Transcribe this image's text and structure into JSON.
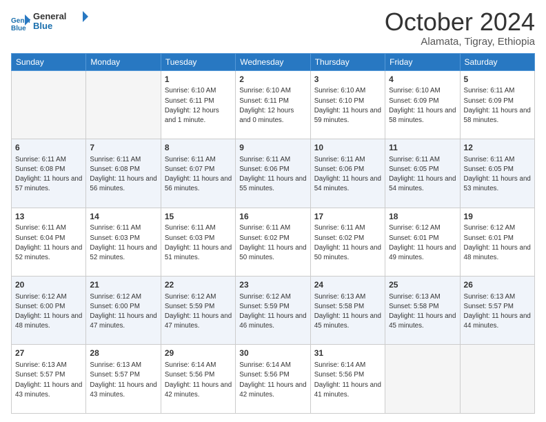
{
  "header": {
    "logo_line1": "General",
    "logo_line2": "Blue",
    "month": "October 2024",
    "location": "Alamata, Tigray, Ethiopia"
  },
  "weekdays": [
    "Sunday",
    "Monday",
    "Tuesday",
    "Wednesday",
    "Thursday",
    "Friday",
    "Saturday"
  ],
  "weeks": [
    [
      {
        "day": "",
        "info": ""
      },
      {
        "day": "",
        "info": ""
      },
      {
        "day": "1",
        "info": "Sunrise: 6:10 AM\nSunset: 6:11 PM\nDaylight: 12 hours\nand 1 minute."
      },
      {
        "day": "2",
        "info": "Sunrise: 6:10 AM\nSunset: 6:11 PM\nDaylight: 12 hours\nand 0 minutes."
      },
      {
        "day": "3",
        "info": "Sunrise: 6:10 AM\nSunset: 6:10 PM\nDaylight: 11 hours\nand 59 minutes."
      },
      {
        "day": "4",
        "info": "Sunrise: 6:10 AM\nSunset: 6:09 PM\nDaylight: 11 hours\nand 58 minutes."
      },
      {
        "day": "5",
        "info": "Sunrise: 6:11 AM\nSunset: 6:09 PM\nDaylight: 11 hours\nand 58 minutes."
      }
    ],
    [
      {
        "day": "6",
        "info": "Sunrise: 6:11 AM\nSunset: 6:08 PM\nDaylight: 11 hours\nand 57 minutes."
      },
      {
        "day": "7",
        "info": "Sunrise: 6:11 AM\nSunset: 6:08 PM\nDaylight: 11 hours\nand 56 minutes."
      },
      {
        "day": "8",
        "info": "Sunrise: 6:11 AM\nSunset: 6:07 PM\nDaylight: 11 hours\nand 56 minutes."
      },
      {
        "day": "9",
        "info": "Sunrise: 6:11 AM\nSunset: 6:06 PM\nDaylight: 11 hours\nand 55 minutes."
      },
      {
        "day": "10",
        "info": "Sunrise: 6:11 AM\nSunset: 6:06 PM\nDaylight: 11 hours\nand 54 minutes."
      },
      {
        "day": "11",
        "info": "Sunrise: 6:11 AM\nSunset: 6:05 PM\nDaylight: 11 hours\nand 54 minutes."
      },
      {
        "day": "12",
        "info": "Sunrise: 6:11 AM\nSunset: 6:05 PM\nDaylight: 11 hours\nand 53 minutes."
      }
    ],
    [
      {
        "day": "13",
        "info": "Sunrise: 6:11 AM\nSunset: 6:04 PM\nDaylight: 11 hours\nand 52 minutes."
      },
      {
        "day": "14",
        "info": "Sunrise: 6:11 AM\nSunset: 6:03 PM\nDaylight: 11 hours\nand 52 minutes."
      },
      {
        "day": "15",
        "info": "Sunrise: 6:11 AM\nSunset: 6:03 PM\nDaylight: 11 hours\nand 51 minutes."
      },
      {
        "day": "16",
        "info": "Sunrise: 6:11 AM\nSunset: 6:02 PM\nDaylight: 11 hours\nand 50 minutes."
      },
      {
        "day": "17",
        "info": "Sunrise: 6:11 AM\nSunset: 6:02 PM\nDaylight: 11 hours\nand 50 minutes."
      },
      {
        "day": "18",
        "info": "Sunrise: 6:12 AM\nSunset: 6:01 PM\nDaylight: 11 hours\nand 49 minutes."
      },
      {
        "day": "19",
        "info": "Sunrise: 6:12 AM\nSunset: 6:01 PM\nDaylight: 11 hours\nand 48 minutes."
      }
    ],
    [
      {
        "day": "20",
        "info": "Sunrise: 6:12 AM\nSunset: 6:00 PM\nDaylight: 11 hours\nand 48 minutes."
      },
      {
        "day": "21",
        "info": "Sunrise: 6:12 AM\nSunset: 6:00 PM\nDaylight: 11 hours\nand 47 minutes."
      },
      {
        "day": "22",
        "info": "Sunrise: 6:12 AM\nSunset: 5:59 PM\nDaylight: 11 hours\nand 47 minutes."
      },
      {
        "day": "23",
        "info": "Sunrise: 6:12 AM\nSunset: 5:59 PM\nDaylight: 11 hours\nand 46 minutes."
      },
      {
        "day": "24",
        "info": "Sunrise: 6:13 AM\nSunset: 5:58 PM\nDaylight: 11 hours\nand 45 minutes."
      },
      {
        "day": "25",
        "info": "Sunrise: 6:13 AM\nSunset: 5:58 PM\nDaylight: 11 hours\nand 45 minutes."
      },
      {
        "day": "26",
        "info": "Sunrise: 6:13 AM\nSunset: 5:57 PM\nDaylight: 11 hours\nand 44 minutes."
      }
    ],
    [
      {
        "day": "27",
        "info": "Sunrise: 6:13 AM\nSunset: 5:57 PM\nDaylight: 11 hours\nand 43 minutes."
      },
      {
        "day": "28",
        "info": "Sunrise: 6:13 AM\nSunset: 5:57 PM\nDaylight: 11 hours\nand 43 minutes."
      },
      {
        "day": "29",
        "info": "Sunrise: 6:14 AM\nSunset: 5:56 PM\nDaylight: 11 hours\nand 42 minutes."
      },
      {
        "day": "30",
        "info": "Sunrise: 6:14 AM\nSunset: 5:56 PM\nDaylight: 11 hours\nand 42 minutes."
      },
      {
        "day": "31",
        "info": "Sunrise: 6:14 AM\nSunset: 5:56 PM\nDaylight: 11 hours\nand 41 minutes."
      },
      {
        "day": "",
        "info": ""
      },
      {
        "day": "",
        "info": ""
      }
    ]
  ]
}
